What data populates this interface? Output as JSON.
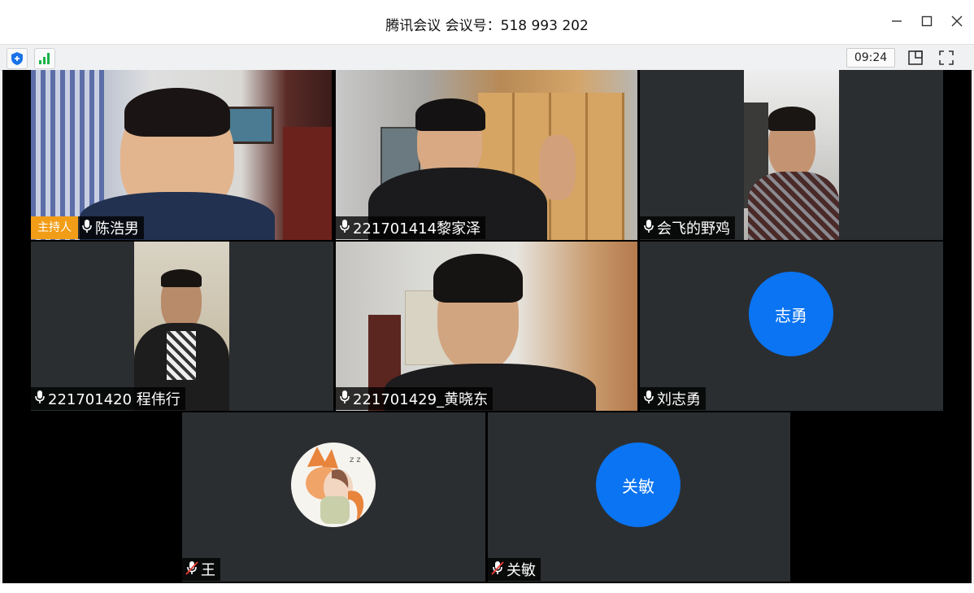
{
  "window": {
    "title": "腾讯会议 会议号：518 993 202"
  },
  "toolbar": {
    "time": "09:24",
    "icons": [
      "shield-icon",
      "signal-icon",
      "layout-icon",
      "fullscreen-icon"
    ]
  },
  "colors": {
    "avatar": "#0a74f2",
    "host_badge": "#f29d17",
    "tile_bg": "#2b2e31",
    "stage_bg": "#000000"
  },
  "participants": [
    {
      "name": "陈浩男",
      "badge": "主持人",
      "mic": "on",
      "video": true
    },
    {
      "name": "221701414黎家泽",
      "mic": "on",
      "video": true
    },
    {
      "name": "会飞的野鸡",
      "mic": "on",
      "video": true
    },
    {
      "name": "221701420 程伟行",
      "mic": "on",
      "video": true
    },
    {
      "name": "221701429_黄晓东",
      "mic": "on",
      "video": true
    },
    {
      "name": "刘志勇",
      "mic": "on",
      "video": false,
      "avatar_text": "志勇"
    },
    {
      "name": "王",
      "mic": "muted",
      "video": false,
      "avatar_image": true
    },
    {
      "name": "关敏",
      "mic": "muted",
      "video": false,
      "avatar_text": "关敏"
    }
  ]
}
